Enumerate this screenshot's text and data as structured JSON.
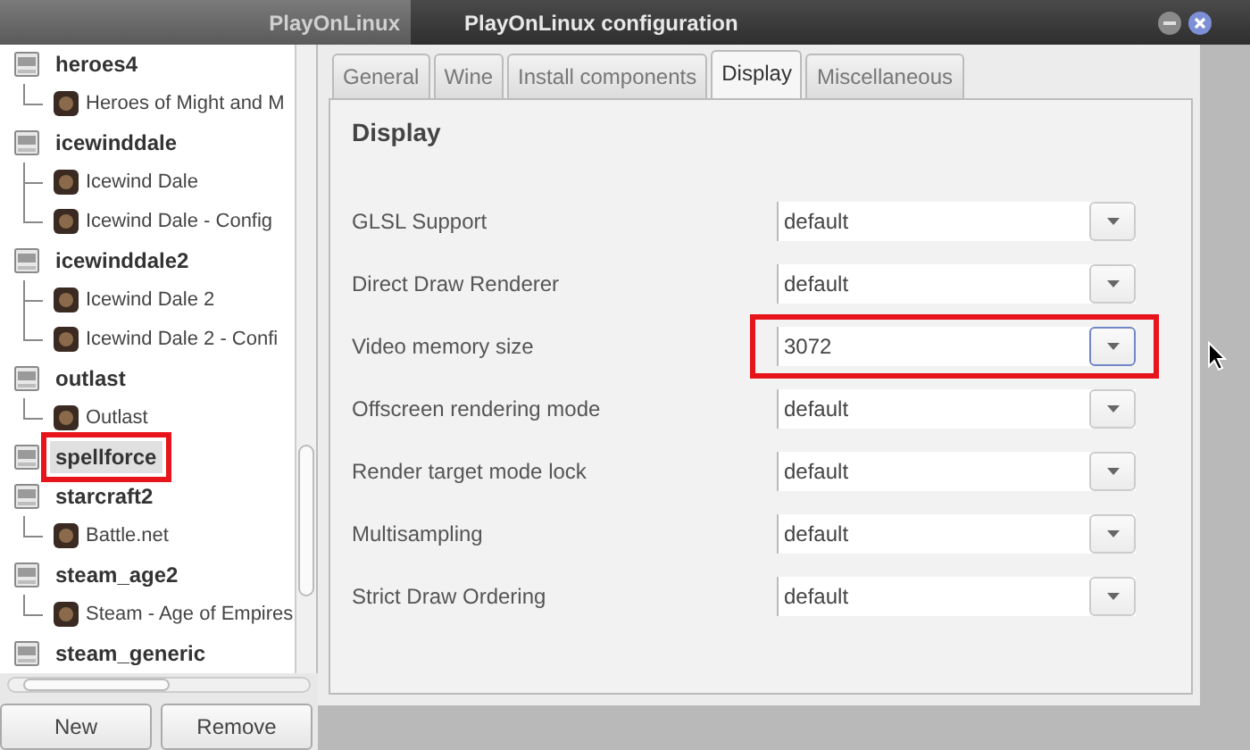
{
  "background_window": {
    "title": "PlayOnLinux"
  },
  "dialog": {
    "title": "PlayOnLinux configuration"
  },
  "tree": [
    {
      "name": "heroes4",
      "highlighted": false,
      "children": [
        {
          "name": "Heroes of Might and M"
        }
      ]
    },
    {
      "name": "icewinddale",
      "highlighted": false,
      "children": [
        {
          "name": "Icewind Dale"
        },
        {
          "name": "Icewind Dale - Config"
        }
      ]
    },
    {
      "name": "icewinddale2",
      "highlighted": false,
      "children": [
        {
          "name": "Icewind Dale 2"
        },
        {
          "name": "Icewind Dale 2 - Confi"
        }
      ]
    },
    {
      "name": "outlast",
      "highlighted": false,
      "children": [
        {
          "name": "Outlast"
        }
      ]
    },
    {
      "name": "spellforce",
      "highlighted": true
    },
    {
      "name": "starcraft2",
      "highlighted": false,
      "children": [
        {
          "name": "Battle.net"
        }
      ]
    },
    {
      "name": "steam_age2",
      "highlighted": false,
      "children": [
        {
          "name": "Steam - Age of Empires"
        }
      ]
    },
    {
      "name": "steam_generic",
      "highlighted": false
    }
  ],
  "buttons": [
    "New",
    "Remove"
  ],
  "tabs": [
    {
      "label": "General",
      "selected": false
    },
    {
      "label": "Wine",
      "selected": false
    },
    {
      "label": "Install components",
      "selected": false
    },
    {
      "label": "Display",
      "selected": true
    },
    {
      "label": "Miscellaneous",
      "selected": false
    }
  ],
  "section_title": "Display",
  "settings": [
    {
      "label": "GLSL Support",
      "value": "default",
      "highlighted": false,
      "focused": false
    },
    {
      "label": "Direct Draw Renderer",
      "value": "default",
      "highlighted": false,
      "focused": false
    },
    {
      "label": "Video memory size",
      "value": "3072",
      "highlighted": true,
      "focused": true
    },
    {
      "label": "Offscreen rendering mode",
      "value": "default",
      "highlighted": false,
      "focused": false
    },
    {
      "label": "Render target mode lock",
      "value": "default",
      "highlighted": false,
      "focused": false
    },
    {
      "label": "Multisampling",
      "value": "default",
      "highlighted": false,
      "focused": false
    },
    {
      "label": "Strict Draw Ordering",
      "value": "default",
      "highlighted": false,
      "focused": false
    }
  ]
}
